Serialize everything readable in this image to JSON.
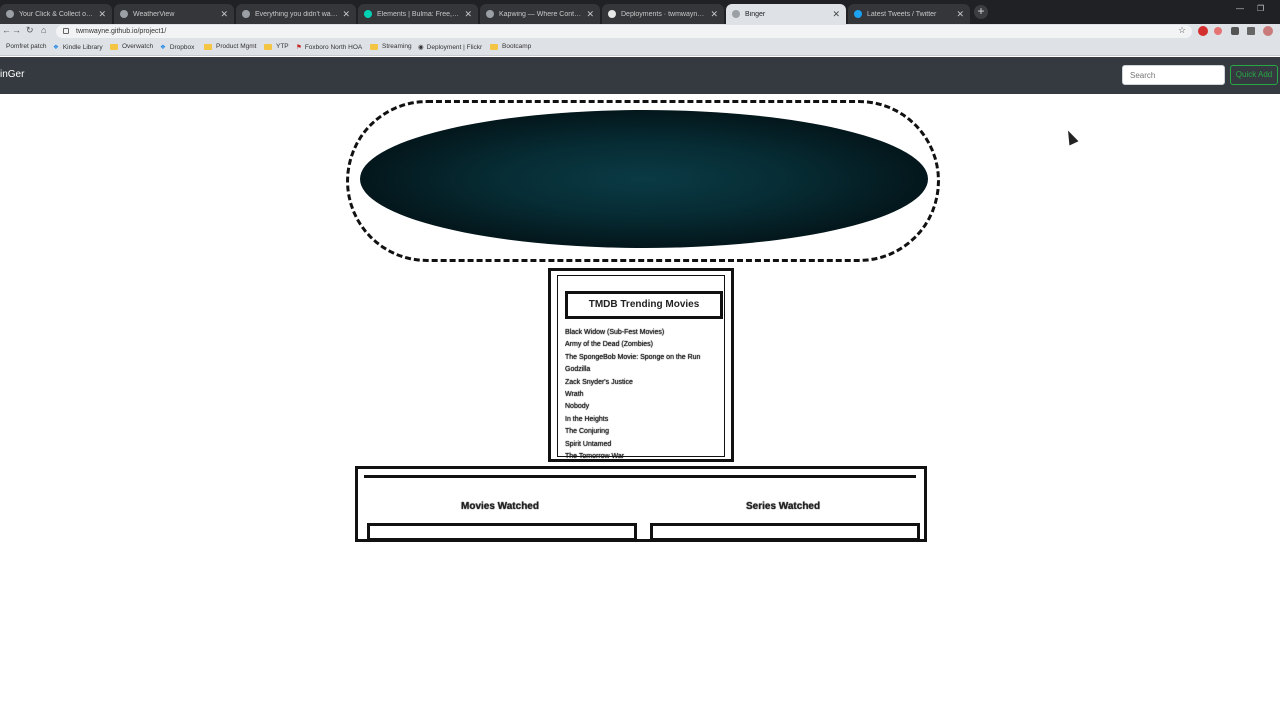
{
  "browser": {
    "tabs": [
      {
        "title": "Your Click & Collect order is rea..."
      },
      {
        "title": "WeatherView"
      },
      {
        "title": "Everything you didn't want to kn..."
      },
      {
        "title": "Elements | Bulma: Free, open so..."
      },
      {
        "title": "Kapwing — Where Content Crea..."
      },
      {
        "title": "Deployments · twmwayne/proj..."
      },
      {
        "title": "Binger"
      },
      {
        "title": "Latest Tweets / Twitter"
      }
    ],
    "active_tab_index": 6,
    "url": "twmwayne.github.io/project1/",
    "bookmarks": [
      "Pomfret patch",
      "Kindle Library",
      "Overwatch",
      "Dropbox",
      "Product Mgmt",
      "YTP",
      "Foxboro North HOA",
      "Streaming",
      "Deployment | Flickr",
      "Bootcamp"
    ]
  },
  "navbar": {
    "brand": "inGer",
    "search_placeholder": "Search",
    "quick_add_label": "Quick Add"
  },
  "trending": {
    "title": "TMDB Trending Movies",
    "movies": [
      "Black Widow (Sub-Fest Movies)",
      "Army of the Dead (Zombies)",
      "The SpongeBob Movie: Sponge on the Run",
      "Godzilla",
      "Zack Snyder's Justice",
      "Wrath",
      "Nobody",
      "In the Heights",
      "The Conjuring",
      "Spirit Untamed",
      "The Tomorrow War"
    ]
  },
  "stats": {
    "movies_label": "Movies Watched",
    "series_label": "Series Watched",
    "movies_progress": 0,
    "series_progress": 0
  }
}
